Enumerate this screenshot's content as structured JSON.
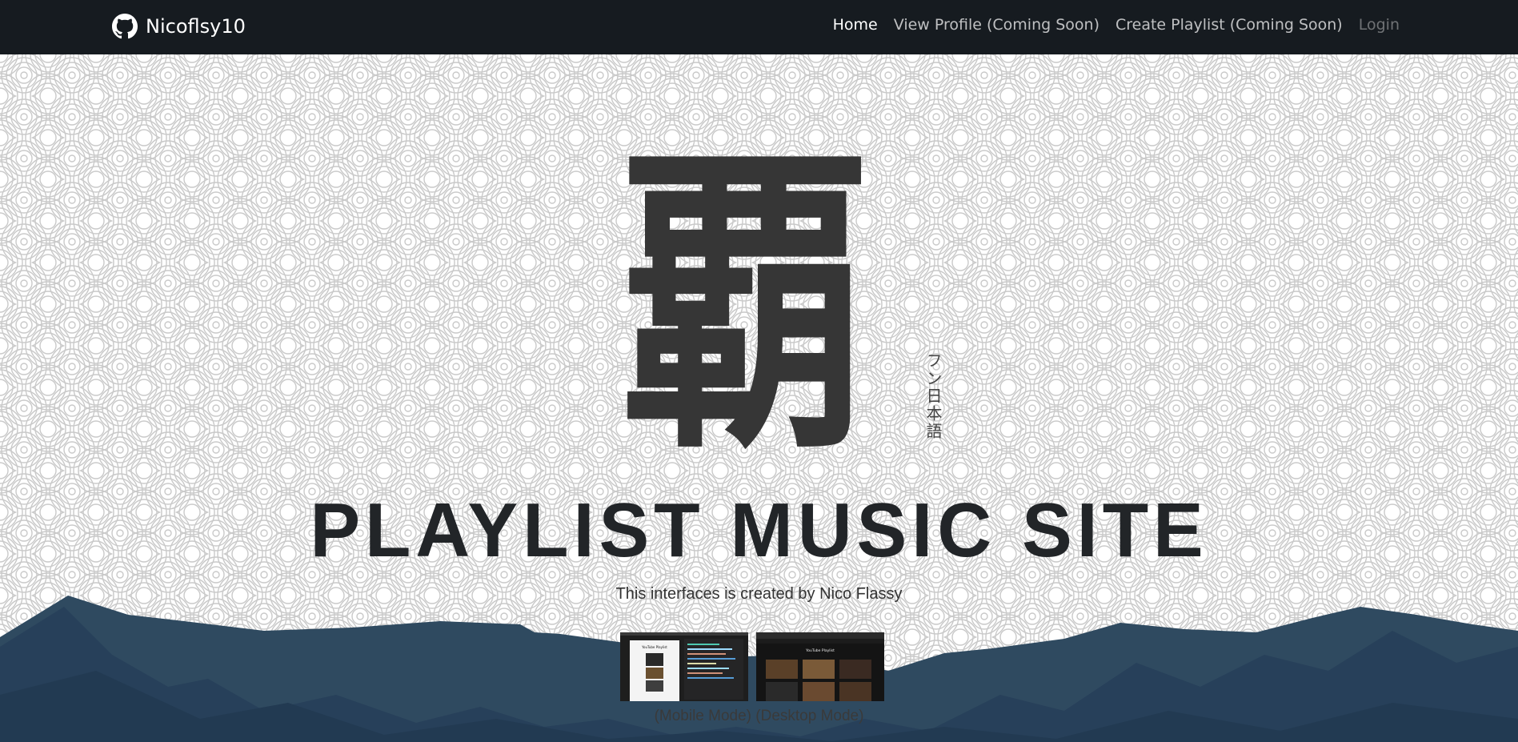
{
  "navbar": {
    "brand_label": "Nicoflsy10",
    "links": [
      {
        "label": "Home"
      },
      {
        "label": "View Profile (Coming Soon)"
      },
      {
        "label": "Create Playlist (Coming Soon)"
      },
      {
        "label": "Login"
      }
    ]
  },
  "hero": {
    "kanji": "覇",
    "vertical_text": "フン日本語",
    "title": "PLAYLIST MUSIC SITE",
    "subtitle": "This interfaces is created by Nico Flassy",
    "thumbs": [
      {
        "header": "YouTube Playlist"
      },
      {
        "header": "YouTube Playlist"
      }
    ],
    "captions": "(Mobile Mode) (Desktop Mode)"
  },
  "colors": {
    "navbar_bg": "#161b20",
    "mountain": "#2f4a60",
    "text_dark": "#222528"
  }
}
